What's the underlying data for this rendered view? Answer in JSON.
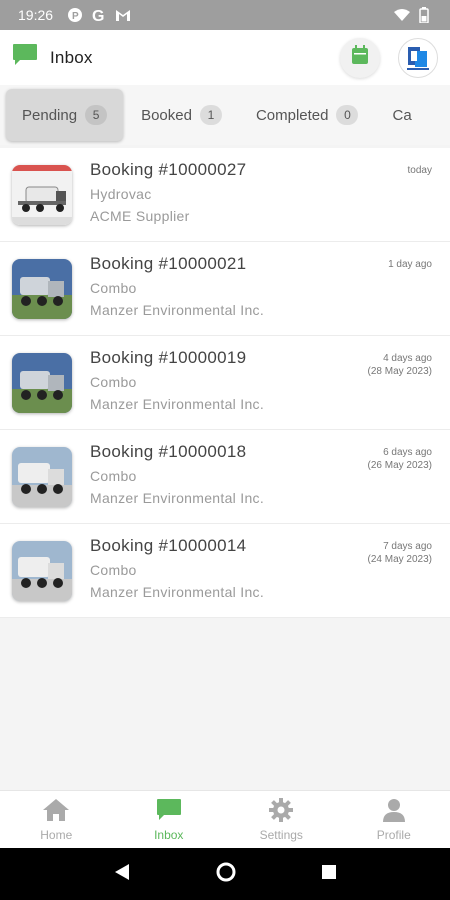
{
  "status_bar": {
    "time": "19:26",
    "left_icons": [
      "parking-app-icon",
      "google-icon",
      "gmail-icon"
    ],
    "right_icons": [
      "wifi-icon",
      "battery-icon"
    ]
  },
  "header": {
    "title": "Inbox"
  },
  "tabs": [
    {
      "label": "Pending",
      "count": "5",
      "active": true
    },
    {
      "label": "Booked",
      "count": "1",
      "active": false
    },
    {
      "label": "Completed",
      "count": "0",
      "active": false
    },
    {
      "label": "Ca",
      "count": "",
      "active": false
    }
  ],
  "bookings": [
    {
      "title": "Booking #10000027",
      "service": "Hydrovac",
      "supplier": "ACME Supplier",
      "when": "today",
      "date": ""
    },
    {
      "title": "Booking #10000021",
      "service": "Combo",
      "supplier": "Manzer Environmental Inc.",
      "when": "1 day ago",
      "date": ""
    },
    {
      "title": "Booking #10000019",
      "service": "Combo",
      "supplier": "Manzer Environmental Inc.",
      "when": "4 days ago",
      "date": "(28 May 2023)"
    },
    {
      "title": "Booking #10000018",
      "service": "Combo",
      "supplier": "Manzer Environmental Inc.",
      "when": "6 days ago",
      "date": "(26 May 2023)"
    },
    {
      "title": "Booking #10000014",
      "service": "Combo",
      "supplier": "Manzer Environmental Inc.",
      "when": "7 days ago",
      "date": "(24 May 2023)"
    }
  ],
  "bottom_nav": [
    {
      "label": "Home",
      "icon": "home-icon",
      "active": false
    },
    {
      "label": "Inbox",
      "icon": "chat-icon",
      "active": true
    },
    {
      "label": "Settings",
      "icon": "gear-icon",
      "active": false
    },
    {
      "label": "Profile",
      "icon": "person-icon",
      "active": false
    }
  ],
  "colors": {
    "accent": "#5cb85c",
    "status_bar": "#9e9e9e",
    "inactive": "#aaaaaa"
  }
}
